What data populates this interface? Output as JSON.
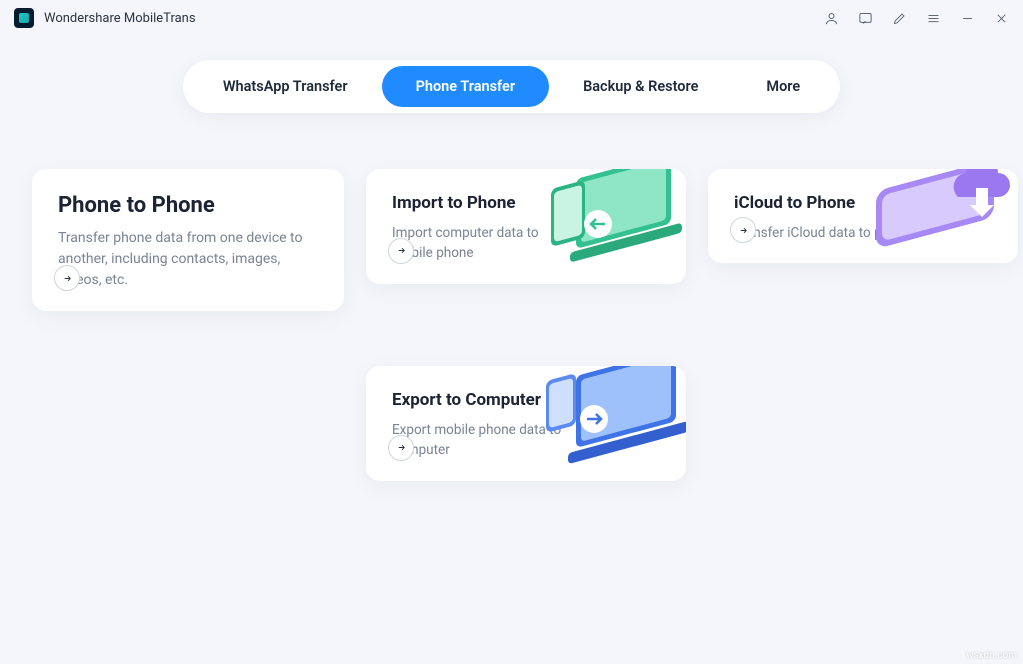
{
  "app": {
    "title": "Wondershare MobileTrans"
  },
  "tabs": {
    "items": [
      {
        "label": "WhatsApp Transfer"
      },
      {
        "label": "Phone Transfer"
      },
      {
        "label": "Backup & Restore"
      },
      {
        "label": "More"
      }
    ],
    "active_index": 1
  },
  "cards": {
    "phone_to_phone": {
      "title": "Phone to Phone",
      "desc": "Transfer phone data from one device to another, including contacts, images, videos, etc."
    },
    "import_to_phone": {
      "title": "Import to Phone",
      "desc": "Import computer data to mobile phone"
    },
    "icloud_to_phone": {
      "title": "iCloud to Phone",
      "desc": "Transfer iCloud data to phone"
    },
    "export_to_computer": {
      "title": "Export to Computer",
      "desc": "Export mobile phone data to computer"
    }
  },
  "colors": {
    "accent": "#1f8bff",
    "card_bg": "#ffffff",
    "page_bg": "#f4f6fb"
  },
  "watermark": "wsxdn.com"
}
